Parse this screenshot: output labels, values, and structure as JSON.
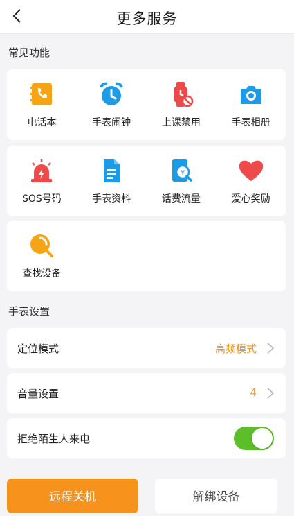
{
  "header": {
    "title": "更多服务"
  },
  "sections": {
    "common": "常见功能",
    "watch_settings": "手表设置"
  },
  "features_row1": [
    {
      "label": "电话本",
      "icon": "phonebook-icon"
    },
    {
      "label": "手表闹钟",
      "icon": "alarm-clock-icon"
    },
    {
      "label": "上课禁用",
      "icon": "class-disable-icon"
    },
    {
      "label": "手表相册",
      "icon": "camera-icon"
    }
  ],
  "features_row2": [
    {
      "label": "SOS号码",
      "icon": "sos-siren-icon"
    },
    {
      "label": "手表资料",
      "icon": "document-icon"
    },
    {
      "label": "话费流量",
      "icon": "billing-icon"
    },
    {
      "label": "爱心奖励",
      "icon": "heart-icon"
    }
  ],
  "features_row3": [
    {
      "label": "查找设备",
      "icon": "find-device-icon"
    }
  ],
  "settings": {
    "location_mode": {
      "label": "定位模式",
      "value": "高频模式"
    },
    "volume": {
      "label": "音量设置",
      "value": "4"
    },
    "reject_strangers": {
      "label": "拒绝陌生人来电",
      "enabled": true
    }
  },
  "buttons": {
    "remote_shutdown": "远程关机",
    "unbind": "解绑设备"
  },
  "colors": {
    "accent": "#f7931d",
    "value_text": "#f0941c",
    "toggle_on": "#5cbf2a",
    "icon_blue": "#1e9be6",
    "icon_red": "#ef4a4a",
    "icon_orange": "#f5a415"
  }
}
